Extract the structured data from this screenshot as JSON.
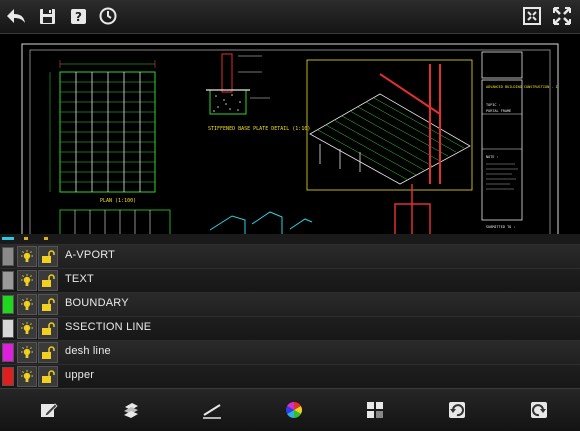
{
  "toolbar_top": {
    "icons": [
      "back-arrow-icon",
      "save-icon",
      "help-icon",
      "history-clock-icon",
      "zoom-extents-icon",
      "fullscreen-icon"
    ]
  },
  "drawing": {
    "labels": {
      "plan": "PLAN (1:100)",
      "detail": "STIFFENED BASE\nPLATE DETAIL (1:10)",
      "submitted": "SUBMITTED TO :",
      "advanced": "ADVANCED\nBUILDING\nCONSTRUCTION - I",
      "topic": "TOPIC :",
      "portal": "PORTAL FRAME",
      "note": "NOTE :"
    }
  },
  "layers": {
    "items": [
      {
        "name": "A-VPORT",
        "color": "#8a8a8a"
      },
      {
        "name": "TEXT",
        "color": "#9a9a9a"
      },
      {
        "name": "BOUNDARY",
        "color": "#1ed81e"
      },
      {
        "name": "SSECTION LINE",
        "color": "#d8d8d8"
      },
      {
        "name": "desh line",
        "color": "#e01ee0"
      },
      {
        "name": "upper",
        "color": "#e01e1e"
      }
    ]
  },
  "toolbar_bottom": {
    "icons": [
      "edit-layer-icon",
      "layers-icon",
      "line-draw-icon",
      "color-wheel-icon",
      "blocks-icon",
      "undo-icon",
      "redo-icon"
    ]
  }
}
